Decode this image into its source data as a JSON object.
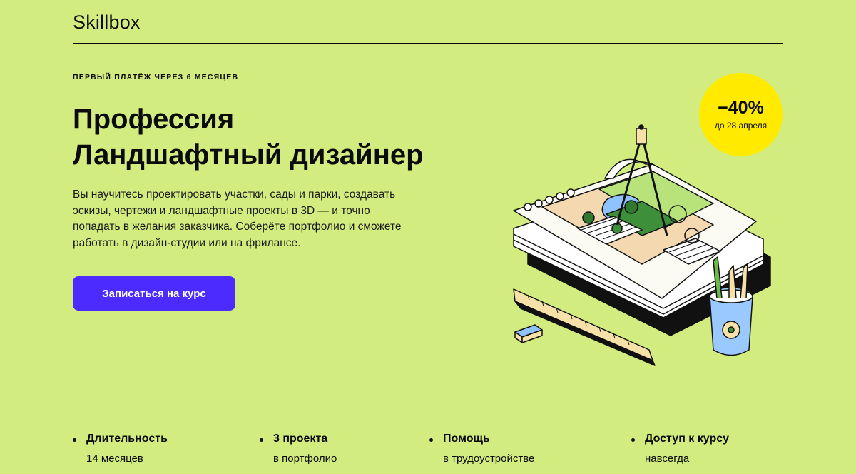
{
  "header": {
    "logo": "Skillbox"
  },
  "hero": {
    "kicker": "Первый платёж через 6 месяцев",
    "title_line1": "Профессия",
    "title_line2": "Ландшафтный дизайнер",
    "description": "Вы научитесь проектировать участки, сады и парки, создавать эскизы, чертежи и ландшафтные проекты в 3D — и точно попадать в желания заказчика. Соберёте портфолио и сможете работать в дизайн-студии или на фрилансе.",
    "cta_label": "Записаться на курс"
  },
  "badge": {
    "discount": "−40%",
    "until": "до 28 апреля"
  },
  "features": [
    {
      "title": "Длительность",
      "subtitle": "14 месяцев"
    },
    {
      "title": "3 проекта",
      "subtitle": "в портфолио"
    },
    {
      "title": "Помощь",
      "subtitle": "в трудоустройстве"
    },
    {
      "title": "Доступ к курсу",
      "subtitle": "навсегда"
    }
  ],
  "colors": {
    "background": "#d2ec80",
    "cta": "#4b2bff",
    "badge": "#ffea00"
  },
  "illustration": {
    "icon": "landscape-plan-illustration"
  }
}
